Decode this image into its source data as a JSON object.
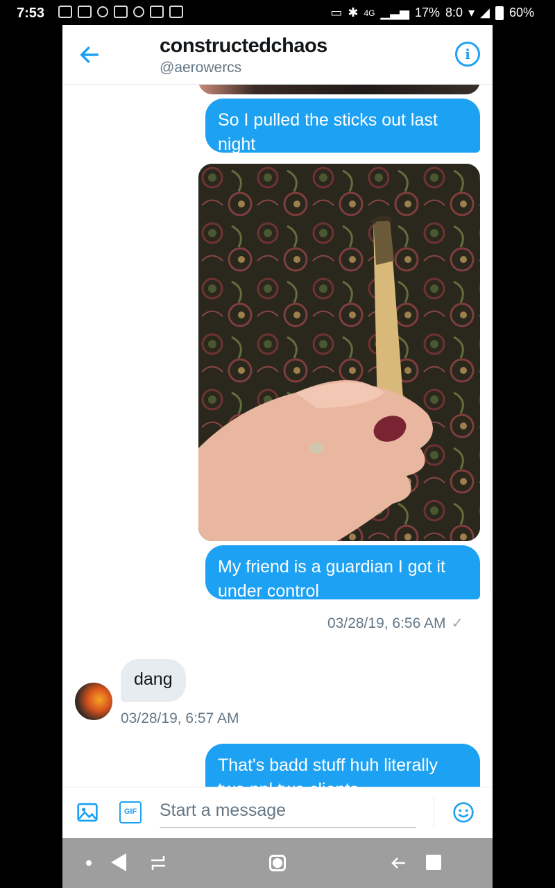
{
  "status_bar": {
    "time": "7:53",
    "data_rate": "8:0",
    "net_label": "4G",
    "battery_small": "17%",
    "battery": "60%"
  },
  "header": {
    "title": "constructedchaos",
    "handle": "@aerowercs",
    "back_icon": "arrow-left-icon",
    "info_icon": "info-icon",
    "info_glyph": "i"
  },
  "conversation": {
    "messages": [
      {
        "sender": "me",
        "text": "So I pulled the sticks out last night"
      },
      {
        "sender": "me",
        "type": "photo",
        "icon": "hand-holding-stick-photo"
      },
      {
        "sender": "me",
        "text": "My friend is a guardian I got it under control"
      },
      {
        "sender": "them",
        "text": "dang"
      },
      {
        "sender": "me",
        "text": "That's badd stuff huh literally two ppl two clients"
      }
    ],
    "timestamp_sent": "03/28/19, 6:56 AM",
    "timestamp_received": "03/28/19, 6:57 AM",
    "check": "✓"
  },
  "composer": {
    "placeholder": "Start a message",
    "gif_label": "GIF"
  },
  "colors": {
    "accent": "#1da1f2",
    "incoming_bubble": "#e6ecf0",
    "text_secondary": "#657786"
  }
}
